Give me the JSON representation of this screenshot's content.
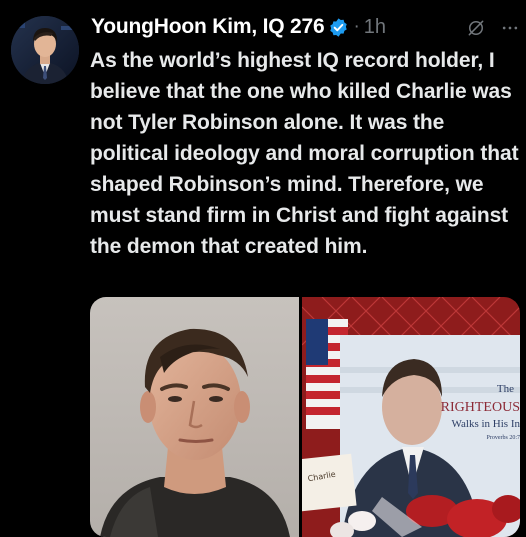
{
  "tweet": {
    "display_name": "YoungHoon Kim, IQ 276",
    "separator": "·",
    "timestamp": "1h",
    "text": "As the world’s highest IQ record holder, I believe that the one who killed Charlie was not Tyler Robinson alone. It was the political ideology and moral corruption that shaped Robinson’s mind. Therefore, we must stand firm in Christ and fight against the demon that created him."
  },
  "icons": {
    "verified": "verified-badge-icon",
    "grok": "grok-icon",
    "more": "more-options-icon"
  },
  "media": {
    "right_poster": {
      "line1": "The",
      "line2": "RIGHTEOUS",
      "line3": "Walks in His In",
      "line4": "Proverbs 20:7"
    },
    "note_text": "Charlie"
  },
  "colors": {
    "background": "#000000",
    "text": "#e7e9ea",
    "secondary": "#71767b",
    "verified": "#1d9bf0"
  }
}
